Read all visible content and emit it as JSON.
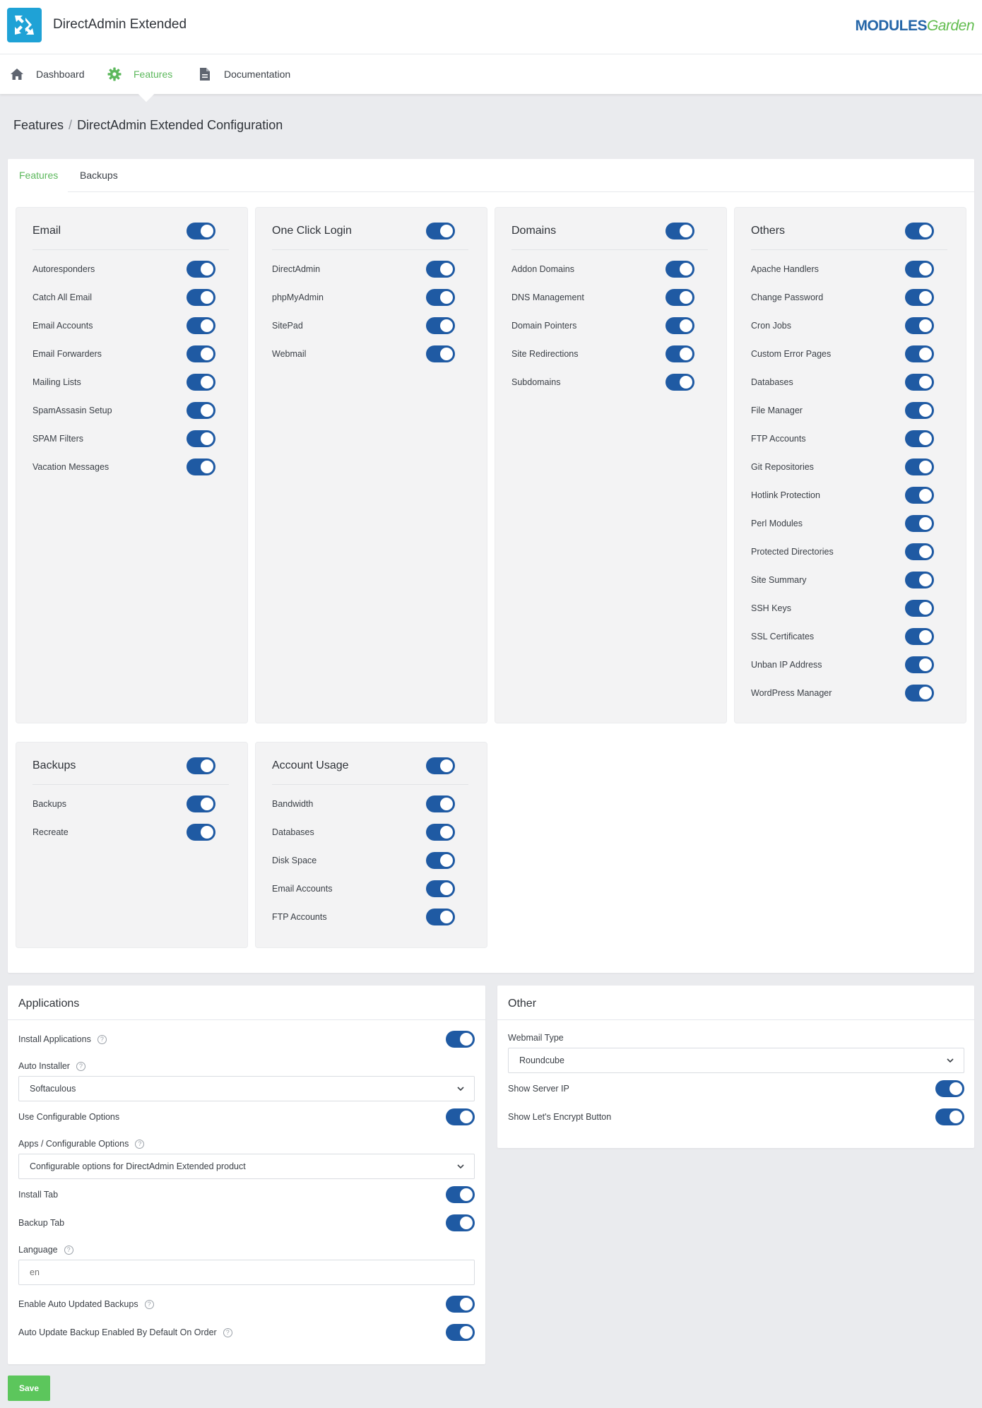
{
  "header": {
    "app_title": "DirectAdmin Extended",
    "brand_left": "MODULES",
    "brand_right": "Garden"
  },
  "nav": {
    "items": [
      {
        "label": "Dashboard",
        "icon": "home-icon",
        "active": false
      },
      {
        "label": "Features",
        "icon": "gear-icon",
        "active": true
      },
      {
        "label": "Documentation",
        "icon": "document-icon",
        "active": false
      }
    ]
  },
  "breadcrumb": {
    "parent": "Features",
    "separator": "/",
    "current": "DirectAdmin Extended Configuration"
  },
  "tabs": [
    {
      "label": "Features",
      "active": true
    },
    {
      "label": "Backups",
      "active": false
    }
  ],
  "groups": [
    {
      "title": "Email",
      "enabled": true,
      "items": [
        "Autoresponders",
        "Catch All Email",
        "Email Accounts",
        "Email Forwarders",
        "Mailing Lists",
        "SpamAssasin Setup",
        "SPAM Filters",
        "Vacation Messages"
      ]
    },
    {
      "title": "One Click Login",
      "enabled": true,
      "items": [
        "DirectAdmin",
        "phpMyAdmin",
        "SitePad",
        "Webmail"
      ]
    },
    {
      "title": "Domains",
      "enabled": true,
      "items": [
        "Addon Domains",
        "DNS Management",
        "Domain Pointers",
        "Site Redirections",
        "Subdomains"
      ]
    },
    {
      "title": "Others",
      "enabled": true,
      "items": [
        "Apache Handlers",
        "Change Password",
        "Cron Jobs",
        "Custom Error Pages",
        "Databases",
        "File Manager",
        "FTP Accounts",
        "Git Repositories",
        "Hotlink Protection",
        "Perl Modules",
        "Protected Directories",
        "Site Summary",
        "SSH Keys",
        "SSL Certificates",
        "Unban IP Address",
        "WordPress Manager"
      ]
    },
    {
      "title": "Backups",
      "enabled": true,
      "items": [
        "Backups",
        "Recreate"
      ]
    },
    {
      "title": "Account Usage",
      "enabled": true,
      "items": [
        "Bandwidth",
        "Databases",
        "Disk Space",
        "Email Accounts",
        "FTP Accounts"
      ]
    }
  ],
  "applications": {
    "title": "Applications",
    "install_applications": "Install Applications",
    "auto_installer": "Auto Installer",
    "auto_installer_value": "Softaculous",
    "use_configurable_options": "Use Configurable Options",
    "apps_configurable_options": "Apps / Configurable Options",
    "apps_configurable_options_value": "Configurable options for DirectAdmin Extended product",
    "install_tab": "Install Tab",
    "backup_tab": "Backup Tab",
    "language": "Language",
    "language_placeholder": "en",
    "enable_auto_updated_backups": "Enable Auto Updated Backups",
    "auto_update_backup_default": "Auto Update Backup Enabled By Default On Order",
    "help_glyph": "?"
  },
  "other": {
    "title": "Other",
    "webmail_type": "Webmail Type",
    "webmail_type_value": "Roundcube",
    "show_server_ip": "Show Server IP",
    "show_lets_encrypt": "Show Let's Encrypt Button"
  },
  "save_label": "Save",
  "colors": {
    "accent_green": "#5cb85c",
    "toggle_blue": "#1f5aa3",
    "logo_blue": "#1fa2d6"
  }
}
